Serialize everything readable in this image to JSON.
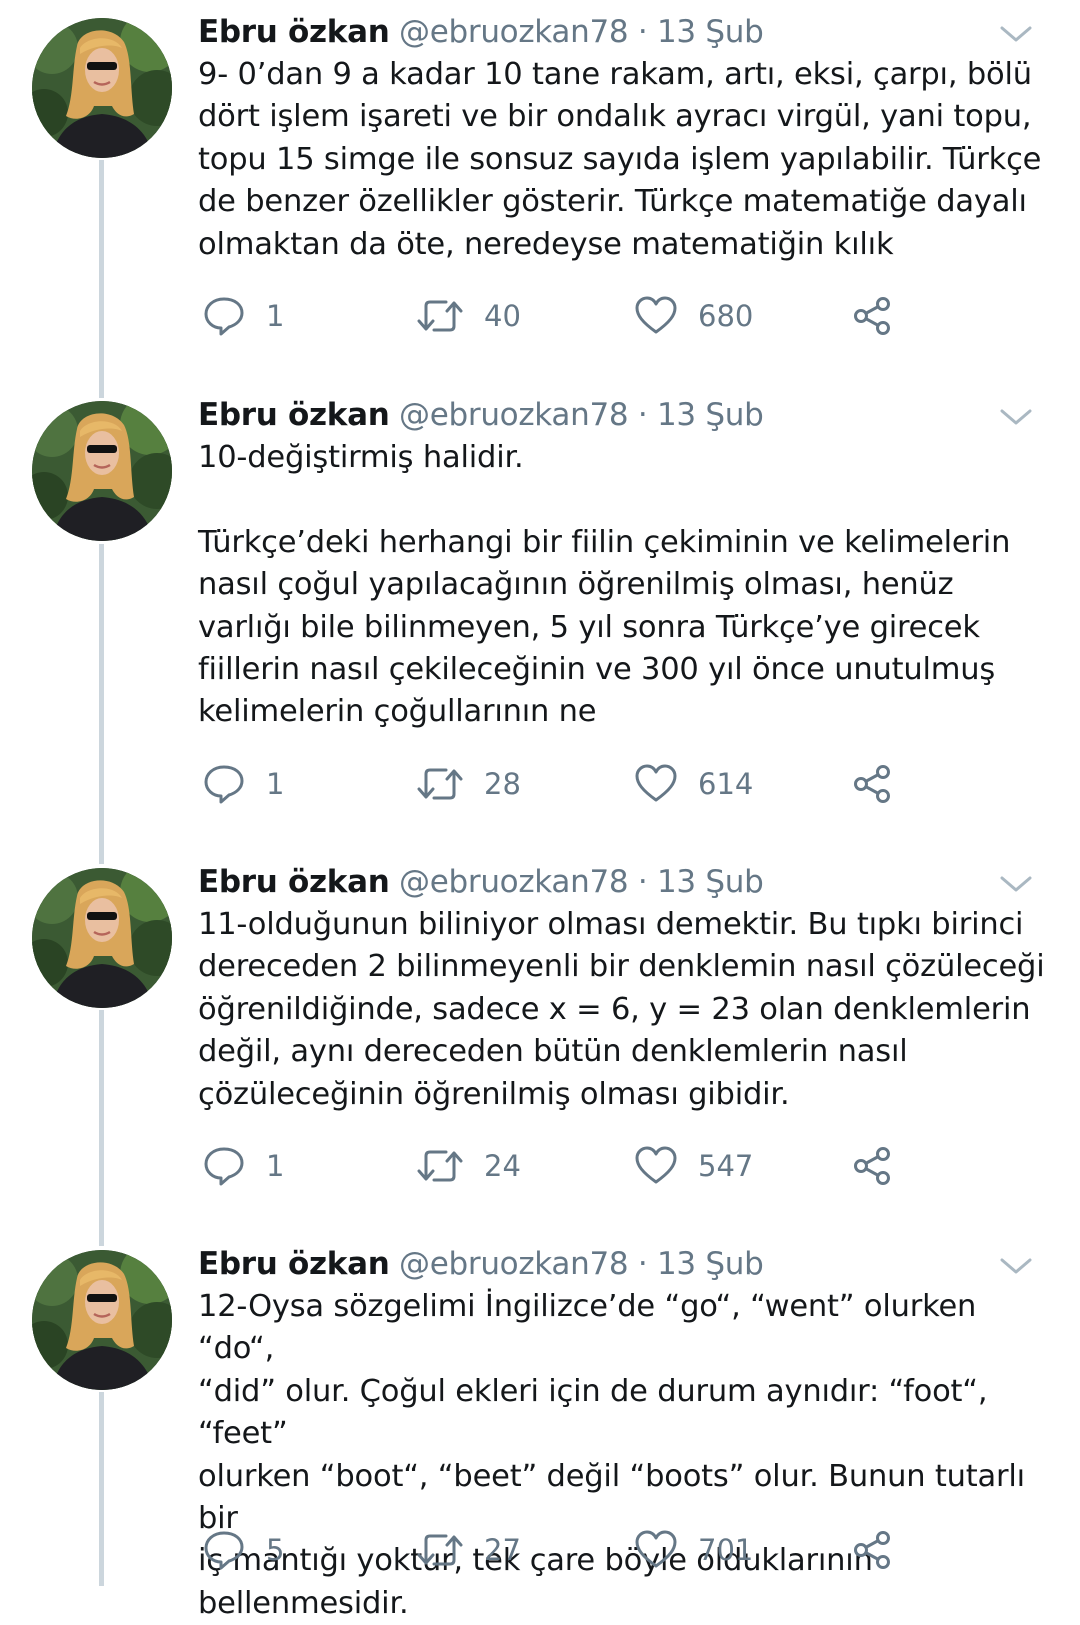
{
  "tweets": [
    {
      "name": "Ebru özkan",
      "handle": "@ebruozkan78",
      "separator": "·",
      "date": "13 Şub",
      "text": "9- 0’dan 9 a kadar 10 tane rakam, artı, eksi, çarpı, bölü\ndört işlem işareti ve bir ondalık ayracı virgül, yani topu,\ntopu 15 simge ile sonsuz sayıda işlem yapılabilir. Türkçe\nde benzer özellikler gösterir. Türkçe matematiğe dayalı\nolmaktan da öte, neredeyse matematiğin kılık",
      "replies": "1",
      "retweets": "40",
      "likes": "680"
    },
    {
      "name": "Ebru özkan",
      "handle": "@ebruozkan78",
      "separator": "·",
      "date": "13 Şub",
      "text": "10-değiştirmiş halidir.\n\nTürkçe’deki herhangi bir fiilin çekiminin ve kelimelerin\nnasıl çoğul yapılacağının öğrenilmiş olması, henüz\nvarlığı bile bilinmeyen, 5 yıl sonra Türkçe’ye girecek\nfiillerin nasıl çekileceğinin ve 300 yıl önce unutulmuş\nkelimelerin çoğullarının ne",
      "replies": "1",
      "retweets": "28",
      "likes": "614"
    },
    {
      "name": "Ebru özkan",
      "handle": "@ebruozkan78",
      "separator": "·",
      "date": "13 Şub",
      "text": "11-olduğunun biliniyor olması demektir. Bu tıpkı birinci\ndereceden 2 bilinmeyenli bir denklemin nasıl çözüleceği\nöğrenildiğinde, sadece x = 6, y = 23 olan denklemlerin\ndeğil, aynı dereceden bütün denklemlerin nasıl\nçözüleceğinin öğrenilmiş olması gibidir.",
      "replies": "1",
      "retweets": "24",
      "likes": "547"
    },
    {
      "name": "Ebru özkan",
      "handle": "@ebruozkan78",
      "separator": "·",
      "date": "13 Şub",
      "text": "12-Oysa sözgelimi İngilizce’de “go“, “went” olurken “do“,\n“did” olur. Çoğul ekleri için de durum aynıdır: “foot“, “feet”\nolurken “boot“, “beet” değil “boots” olur. Bunun tutarlı bir\niç mantığı yoktur, tek çare böyle olduklarının\nbellenmesidir.",
      "replies": "5",
      "retweets": "27",
      "likes": "701"
    }
  ],
  "colors": {
    "text_primary": "#14171a",
    "text_secondary": "#657786",
    "thread_line": "#ccd6dd"
  },
  "icons": {
    "reply": "reply-icon",
    "retweet": "retweet-icon",
    "like": "like-icon",
    "share": "share-icon",
    "menu": "chevron-down-icon"
  }
}
